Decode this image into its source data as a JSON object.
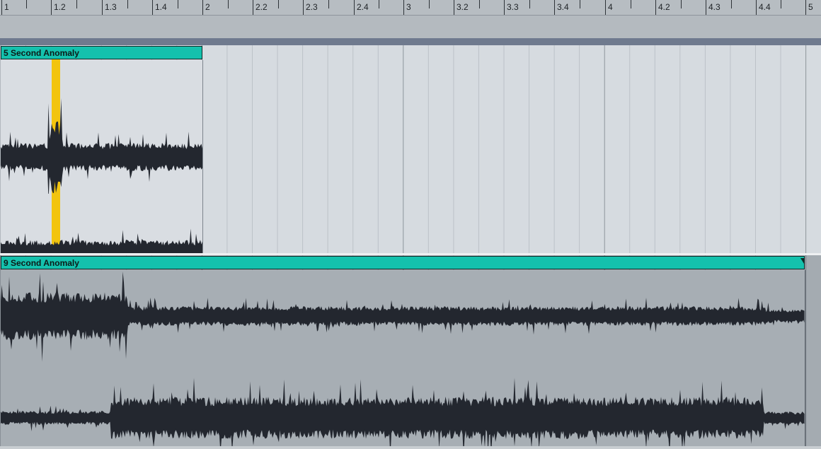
{
  "ruler": {
    "labels": [
      "1",
      "1.2",
      "1.3",
      "1.4",
      "2",
      "2.2",
      "2.3",
      "2.4",
      "3",
      "3.2",
      "3.3",
      "3.4",
      "4",
      "4.2",
      "4.3",
      "4.4",
      "5"
    ]
  },
  "clips": [
    {
      "name": "5 Second Anomaly",
      "color": "#14c1ad"
    },
    {
      "name": "9 Second Anomaly",
      "color": "#14c1ad"
    }
  ],
  "selection": {
    "color": "#f2c40f"
  },
  "colors": {
    "waveform": "#23272f",
    "clip_header": "#14c1ad",
    "track_active": "#d6dbe0",
    "track_inactive": "#a4abb1"
  }
}
